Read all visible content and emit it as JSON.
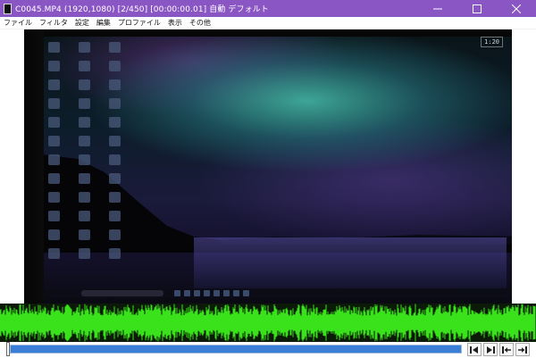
{
  "window": {
    "title": "C0045.MP4 (1920,1080)  [2/450] [00:00:00.01]  自動  デフォルト",
    "controls": {
      "minimize": "–",
      "maximize": "□",
      "close": "✕"
    }
  },
  "menubar": {
    "items": [
      "ファイル",
      "フィルタ",
      "設定",
      "編集",
      "プロファイル",
      "表示",
      "その他"
    ]
  },
  "video": {
    "clock_label": "1:20"
  },
  "seek": {
    "progress": 0.002
  },
  "nav_buttons": [
    "prev-frame-icon",
    "next-frame-icon",
    "go-start-icon",
    "go-end-icon"
  ],
  "colors": {
    "titlebar": "#8a56c4",
    "waveform": "#39e21a",
    "seek_track": "#3a7fd5"
  }
}
